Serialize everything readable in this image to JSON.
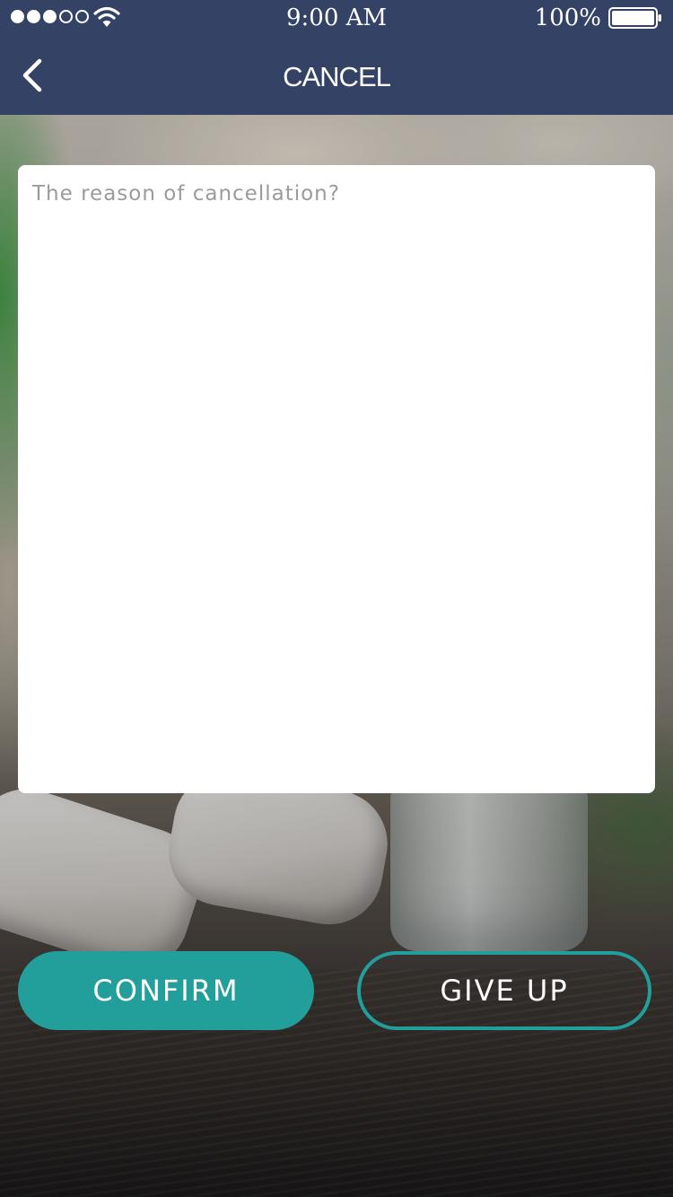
{
  "status_bar": {
    "signal_dots": {
      "filled": 3,
      "total": 5
    },
    "wifi_icon": "wifi-icon",
    "time": "9:00 AM",
    "battery_percent": "100%",
    "battery_icon": "battery-full-icon",
    "battery_level": 1.0
  },
  "nav": {
    "back_icon": "chevron-left-icon",
    "title": "CANCEL"
  },
  "reason": {
    "placeholder": "The reason of cancellation?",
    "value": ""
  },
  "actions": {
    "confirm_label": "CONFIRM",
    "give_up_label": "GIVE UP"
  },
  "colors": {
    "header": "#344265",
    "accent": "#229e9b",
    "card": "#ffffff",
    "placeholder_text": "#9b9b9b"
  }
}
